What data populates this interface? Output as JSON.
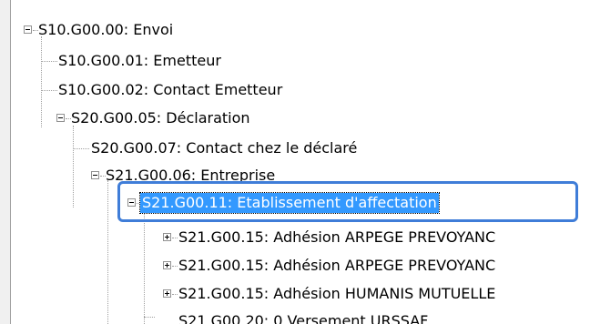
{
  "tree": {
    "nodes": [
      {
        "label": "S10.G00.00: Envoi",
        "expanded": true
      },
      {
        "label": "S10.G00.01: Emetteur"
      },
      {
        "label": "S10.G00.02: Contact Emetteur"
      },
      {
        "label": "S20.G00.05: Déclaration",
        "expanded": true
      },
      {
        "label": "S20.G00.07: Contact chez le déclaré"
      },
      {
        "label": "S21.G00.06: Entreprise",
        "expanded": true
      },
      {
        "label": "S21.G00.11: Etablissement d'affectation",
        "expanded": true,
        "selected": true
      },
      {
        "label": "S21.G00.15: Adhésion ARPEGE PREVOYANC",
        "expanded": false
      },
      {
        "label": "S21.G00.15: Adhésion ARPEGE PREVOYANC",
        "expanded": false
      },
      {
        "label": "S21.G00.15: Adhésion HUMANIS MUTUELLE",
        "expanded": false
      },
      {
        "label": "S21.G00.20: 0 Versement URSSAF"
      }
    ]
  },
  "colors": {
    "selection": "#3399ff",
    "annotation_border": "#3f7dd8",
    "tree_lines": "#a0a0a0"
  }
}
